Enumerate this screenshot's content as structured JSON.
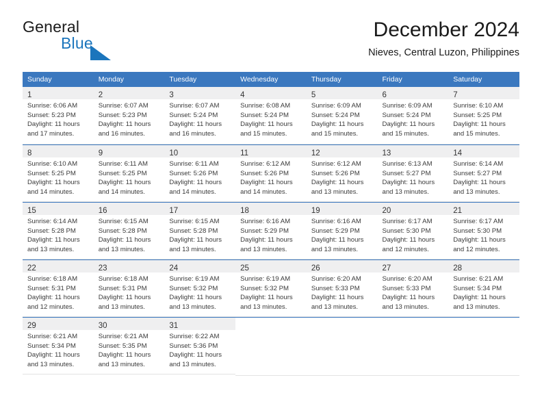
{
  "brand": {
    "name_part1": "General",
    "name_part2": "Blue",
    "mark": "triangle-flag-icon",
    "accent_color": "#1b75bc"
  },
  "header": {
    "title": "December 2024",
    "subtitle": "Nieves, Central Luzon, Philippines"
  },
  "theme": {
    "header_row_bg": "#3b78bf",
    "header_row_text": "#ffffff",
    "daynum_shaded_bg": "#efeff0",
    "cell_border": "#e3e3e3"
  },
  "weekdays": [
    "Sunday",
    "Monday",
    "Tuesday",
    "Wednesday",
    "Thursday",
    "Friday",
    "Saturday"
  ],
  "weeks": [
    [
      {
        "day": "1",
        "sunrise": "Sunrise: 6:06 AM",
        "sunset": "Sunset: 5:23 PM",
        "daylight1": "Daylight: 11 hours",
        "daylight2": "and 17 minutes."
      },
      {
        "day": "2",
        "sunrise": "Sunrise: 6:07 AM",
        "sunset": "Sunset: 5:23 PM",
        "daylight1": "Daylight: 11 hours",
        "daylight2": "and 16 minutes."
      },
      {
        "day": "3",
        "sunrise": "Sunrise: 6:07 AM",
        "sunset": "Sunset: 5:24 PM",
        "daylight1": "Daylight: 11 hours",
        "daylight2": "and 16 minutes."
      },
      {
        "day": "4",
        "sunrise": "Sunrise: 6:08 AM",
        "sunset": "Sunset: 5:24 PM",
        "daylight1": "Daylight: 11 hours",
        "daylight2": "and 15 minutes."
      },
      {
        "day": "5",
        "sunrise": "Sunrise: 6:09 AM",
        "sunset": "Sunset: 5:24 PM",
        "daylight1": "Daylight: 11 hours",
        "daylight2": "and 15 minutes."
      },
      {
        "day": "6",
        "sunrise": "Sunrise: 6:09 AM",
        "sunset": "Sunset: 5:24 PM",
        "daylight1": "Daylight: 11 hours",
        "daylight2": "and 15 minutes."
      },
      {
        "day": "7",
        "sunrise": "Sunrise: 6:10 AM",
        "sunset": "Sunset: 5:25 PM",
        "daylight1": "Daylight: 11 hours",
        "daylight2": "and 15 minutes."
      }
    ],
    [
      {
        "day": "8",
        "sunrise": "Sunrise: 6:10 AM",
        "sunset": "Sunset: 5:25 PM",
        "daylight1": "Daylight: 11 hours",
        "daylight2": "and 14 minutes."
      },
      {
        "day": "9",
        "sunrise": "Sunrise: 6:11 AM",
        "sunset": "Sunset: 5:25 PM",
        "daylight1": "Daylight: 11 hours",
        "daylight2": "and 14 minutes."
      },
      {
        "day": "10",
        "sunrise": "Sunrise: 6:11 AM",
        "sunset": "Sunset: 5:26 PM",
        "daylight1": "Daylight: 11 hours",
        "daylight2": "and 14 minutes."
      },
      {
        "day": "11",
        "sunrise": "Sunrise: 6:12 AM",
        "sunset": "Sunset: 5:26 PM",
        "daylight1": "Daylight: 11 hours",
        "daylight2": "and 14 minutes."
      },
      {
        "day": "12",
        "sunrise": "Sunrise: 6:12 AM",
        "sunset": "Sunset: 5:26 PM",
        "daylight1": "Daylight: 11 hours",
        "daylight2": "and 13 minutes."
      },
      {
        "day": "13",
        "sunrise": "Sunrise: 6:13 AM",
        "sunset": "Sunset: 5:27 PM",
        "daylight1": "Daylight: 11 hours",
        "daylight2": "and 13 minutes."
      },
      {
        "day": "14",
        "sunrise": "Sunrise: 6:14 AM",
        "sunset": "Sunset: 5:27 PM",
        "daylight1": "Daylight: 11 hours",
        "daylight2": "and 13 minutes."
      }
    ],
    [
      {
        "day": "15",
        "sunrise": "Sunrise: 6:14 AM",
        "sunset": "Sunset: 5:28 PM",
        "daylight1": "Daylight: 11 hours",
        "daylight2": "and 13 minutes."
      },
      {
        "day": "16",
        "sunrise": "Sunrise: 6:15 AM",
        "sunset": "Sunset: 5:28 PM",
        "daylight1": "Daylight: 11 hours",
        "daylight2": "and 13 minutes."
      },
      {
        "day": "17",
        "sunrise": "Sunrise: 6:15 AM",
        "sunset": "Sunset: 5:28 PM",
        "daylight1": "Daylight: 11 hours",
        "daylight2": "and 13 minutes."
      },
      {
        "day": "18",
        "sunrise": "Sunrise: 6:16 AM",
        "sunset": "Sunset: 5:29 PM",
        "daylight1": "Daylight: 11 hours",
        "daylight2": "and 13 minutes."
      },
      {
        "day": "19",
        "sunrise": "Sunrise: 6:16 AM",
        "sunset": "Sunset: 5:29 PM",
        "daylight1": "Daylight: 11 hours",
        "daylight2": "and 13 minutes."
      },
      {
        "day": "20",
        "sunrise": "Sunrise: 6:17 AM",
        "sunset": "Sunset: 5:30 PM",
        "daylight1": "Daylight: 11 hours",
        "daylight2": "and 12 minutes."
      },
      {
        "day": "21",
        "sunrise": "Sunrise: 6:17 AM",
        "sunset": "Sunset: 5:30 PM",
        "daylight1": "Daylight: 11 hours",
        "daylight2": "and 12 minutes."
      }
    ],
    [
      {
        "day": "22",
        "sunrise": "Sunrise: 6:18 AM",
        "sunset": "Sunset: 5:31 PM",
        "daylight1": "Daylight: 11 hours",
        "daylight2": "and 12 minutes."
      },
      {
        "day": "23",
        "sunrise": "Sunrise: 6:18 AM",
        "sunset": "Sunset: 5:31 PM",
        "daylight1": "Daylight: 11 hours",
        "daylight2": "and 13 minutes."
      },
      {
        "day": "24",
        "sunrise": "Sunrise: 6:19 AM",
        "sunset": "Sunset: 5:32 PM",
        "daylight1": "Daylight: 11 hours",
        "daylight2": "and 13 minutes."
      },
      {
        "day": "25",
        "sunrise": "Sunrise: 6:19 AM",
        "sunset": "Sunset: 5:32 PM",
        "daylight1": "Daylight: 11 hours",
        "daylight2": "and 13 minutes."
      },
      {
        "day": "26",
        "sunrise": "Sunrise: 6:20 AM",
        "sunset": "Sunset: 5:33 PM",
        "daylight1": "Daylight: 11 hours",
        "daylight2": "and 13 minutes."
      },
      {
        "day": "27",
        "sunrise": "Sunrise: 6:20 AM",
        "sunset": "Sunset: 5:33 PM",
        "daylight1": "Daylight: 11 hours",
        "daylight2": "and 13 minutes."
      },
      {
        "day": "28",
        "sunrise": "Sunrise: 6:21 AM",
        "sunset": "Sunset: 5:34 PM",
        "daylight1": "Daylight: 11 hours",
        "daylight2": "and 13 minutes."
      }
    ],
    [
      {
        "day": "29",
        "sunrise": "Sunrise: 6:21 AM",
        "sunset": "Sunset: 5:34 PM",
        "daylight1": "Daylight: 11 hours",
        "daylight2": "and 13 minutes."
      },
      {
        "day": "30",
        "sunrise": "Sunrise: 6:21 AM",
        "sunset": "Sunset: 5:35 PM",
        "daylight1": "Daylight: 11 hours",
        "daylight2": "and 13 minutes."
      },
      {
        "day": "31",
        "sunrise": "Sunrise: 6:22 AM",
        "sunset": "Sunset: 5:36 PM",
        "daylight1": "Daylight: 11 hours",
        "daylight2": "and 13 minutes."
      },
      null,
      null,
      null,
      null
    ]
  ]
}
